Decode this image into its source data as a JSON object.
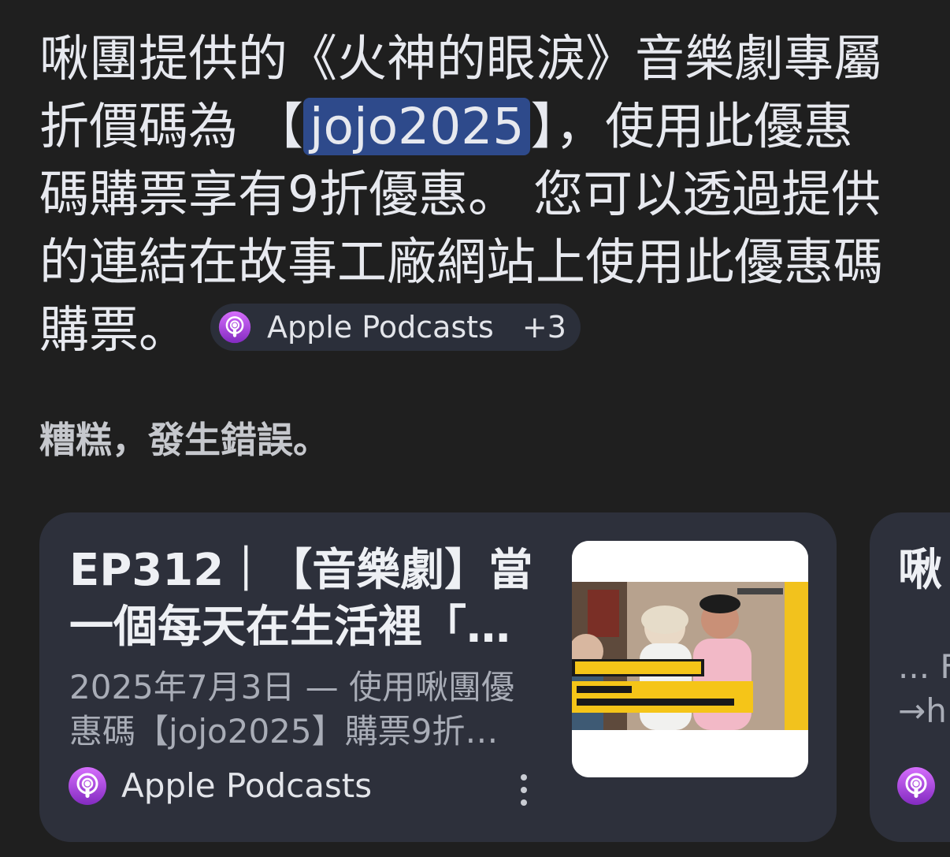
{
  "answer": {
    "text_before": "啾團提供的《火神的眼淚》音樂劇專屬折價碼為 【",
    "highlight": "jojo2025",
    "text_after": "】，使用此優惠碼購票享有9折優惠。 您可以透過提供的連結在故事工廠網站上使用此優惠碼購票。",
    "source_chip": {
      "label": "Apple Podcasts",
      "more": "+3",
      "icon": "podcasts-icon"
    }
  },
  "error_message": "糟糕，發生錯誤。",
  "cards": [
    {
      "title": "EP312｜【音樂劇】當\n一個每天在生活裡「…",
      "snippet": "2025年7月3日 — 使用啾團優\n惠碼【jojo2025】購票9折…",
      "source": "Apple Podcasts",
      "source_icon": "podcasts-icon",
      "thumbnail": "episode-thumbnail"
    },
    {
      "title": "啾",
      "snippet": "... F\n→h",
      "source_icon": "podcasts-icon"
    }
  ],
  "colors": {
    "background": "#1f1f1f",
    "card": "#2d303b",
    "highlight": "#2e4a8b",
    "podcasts_purple": "#a855f7"
  }
}
